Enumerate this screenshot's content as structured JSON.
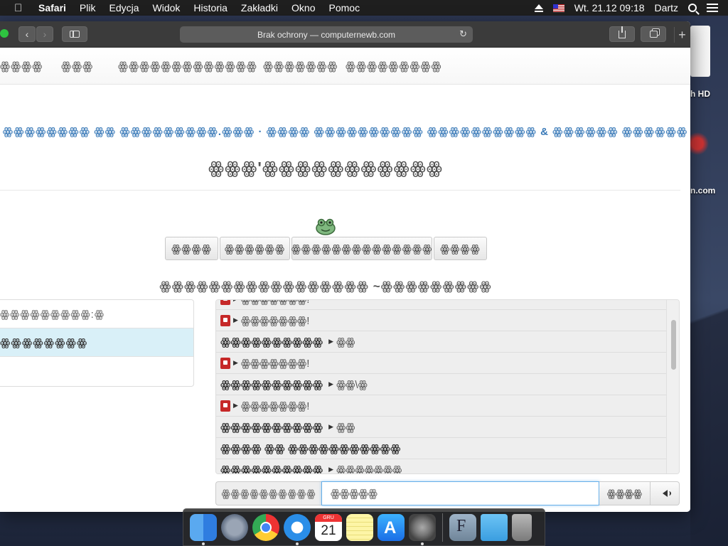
{
  "menubar": {
    "apple": "",
    "app_name": "Safari",
    "items": [
      "Plik",
      "Edycja",
      "Widok",
      "Historia",
      "Zakładki",
      "Okno",
      "Pomoc"
    ],
    "datetime": "Wt. 21.12  09:18",
    "user": "Dartz"
  },
  "desktop": {
    "disk_label": "h HD",
    "domain_label": "n.com"
  },
  "browser": {
    "address": "Brak ochrony — computernewb.com",
    "new_tab": "+"
  },
  "page": {
    "nav_items": [
      "ꙮꙮꙮꙮ",
      "ꙮꙮꙮ",
      "ꙮꙮꙮꙮꙮꙮꙮꙮꙮꙮꙮꙮꙮ",
      "ꙮꙮꙮꙮꙮꙮꙮ",
      "ꙮꙮꙮꙮꙮꙮꙮꙮꙮ"
    ],
    "blue_line": "ꙮꙮꙮꙮꙮꙮꙮꙮ ꙮꙮ ꙮꙮꙮꙮꙮꙮꙮꙮꙮ.ꙮꙮꙮ · ꙮꙮꙮꙮ ꙮꙮꙮꙮꙮꙮꙮꙮꙮꙮ ꙮꙮꙮꙮꙮꙮꙮꙮꙮꙮ & ꙮꙮꙮꙮꙮꙮ ꙮꙮꙮꙮꙮꙮ",
    "title": "ꙮꙮꙮ'ꙮꙮꙮꙮꙮꙮꙮꙮꙮꙮꙮ",
    "buttons": [
      "ꙮꙮꙮꙮ",
      "ꙮꙮꙮꙮꙮꙮ",
      "ꙮꙮꙮꙮꙮꙮꙮꙮꙮꙮꙮꙮꙮꙮ",
      "ꙮꙮꙮꙮ"
    ],
    "subtitle": "ꙮꙮꙮꙮꙮꙮꙮꙮꙮꙮꙮꙮꙮꙮꙮꙮꙮ ~ꙮꙮꙮꙮꙮꙮꙮꙮꙮ",
    "left_panel": [
      "ꙮꙮꙮꙮꙮꙮꙮꙮꙮ:ꙮ",
      "ꙮꙮꙮꙮꙮꙮꙮꙮ"
    ],
    "chat": [
      {
        "pin": true,
        "name": "",
        "text": "ꙮꙮꙮꙮꙮꙮꙮ!"
      },
      {
        "pin": true,
        "name": "",
        "text": "ꙮꙮꙮꙮꙮꙮꙮ!"
      },
      {
        "pin": false,
        "name": "ꙮꙮꙮꙮꙮꙮꙮꙮꙮꙮ",
        "text": "ꙮꙮ"
      },
      {
        "pin": true,
        "name": "",
        "text": "ꙮꙮꙮꙮꙮꙮꙮ!"
      },
      {
        "pin": false,
        "name": "ꙮꙮꙮꙮꙮꙮꙮꙮꙮꙮ",
        "text": "ꙮꙮ\\ꙮ"
      },
      {
        "pin": true,
        "name": "",
        "text": "ꙮꙮꙮꙮꙮꙮꙮ!"
      },
      {
        "pin": false,
        "name": "ꙮꙮꙮꙮꙮꙮꙮꙮꙮꙮ",
        "text": "ꙮꙮ"
      },
      {
        "pin": false,
        "name": "ꙮꙮꙮꙮ ꙮꙮ ꙮꙮꙮꙮꙮꙮꙮꙮꙮꙮꙮ",
        "text": ""
      },
      {
        "pin": false,
        "name": "ꙮꙮꙮꙮꙮꙮꙮꙮꙮꙮ",
        "text": "ꙮꙮꙮꙮꙮꙮꙮ"
      }
    ],
    "input_label": "ꙮꙮꙮꙮꙮꙮꙮꙮꙮꙮ",
    "input_value": "ꙮꙮꙮꙮꙮ",
    "send_label": "ꙮꙮꙮꙮ"
  },
  "dock": {
    "calendar_month": "GRU",
    "calendar_day": "21"
  },
  "colors": {
    "accent_blue": "#3a7ab8",
    "selected_row": "#d9f0f8",
    "window_toolbar": "#3b3b3b"
  }
}
